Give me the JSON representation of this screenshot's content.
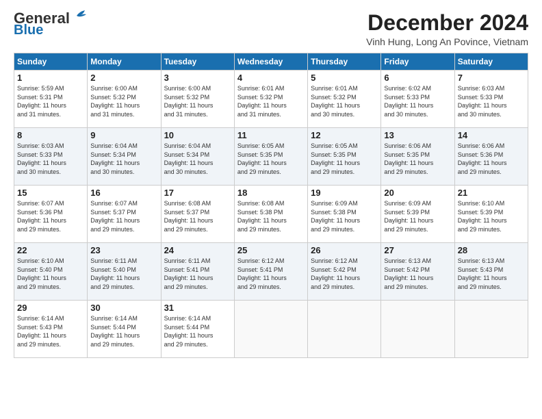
{
  "logo": {
    "general": "General",
    "blue": "Blue"
  },
  "header": {
    "month_year": "December 2024",
    "location": "Vinh Hung, Long An Povince, Vietnam"
  },
  "weekdays": [
    "Sunday",
    "Monday",
    "Tuesday",
    "Wednesday",
    "Thursday",
    "Friday",
    "Saturday"
  ],
  "weeks": [
    [
      {
        "day": "1",
        "info": "Sunrise: 5:59 AM\nSunset: 5:31 PM\nDaylight: 11 hours\nand 31 minutes."
      },
      {
        "day": "2",
        "info": "Sunrise: 6:00 AM\nSunset: 5:32 PM\nDaylight: 11 hours\nand 31 minutes."
      },
      {
        "day": "3",
        "info": "Sunrise: 6:00 AM\nSunset: 5:32 PM\nDaylight: 11 hours\nand 31 minutes."
      },
      {
        "day": "4",
        "info": "Sunrise: 6:01 AM\nSunset: 5:32 PM\nDaylight: 11 hours\nand 31 minutes."
      },
      {
        "day": "5",
        "info": "Sunrise: 6:01 AM\nSunset: 5:32 PM\nDaylight: 11 hours\nand 30 minutes."
      },
      {
        "day": "6",
        "info": "Sunrise: 6:02 AM\nSunset: 5:33 PM\nDaylight: 11 hours\nand 30 minutes."
      },
      {
        "day": "7",
        "info": "Sunrise: 6:03 AM\nSunset: 5:33 PM\nDaylight: 11 hours\nand 30 minutes."
      }
    ],
    [
      {
        "day": "8",
        "info": "Sunrise: 6:03 AM\nSunset: 5:33 PM\nDaylight: 11 hours\nand 30 minutes."
      },
      {
        "day": "9",
        "info": "Sunrise: 6:04 AM\nSunset: 5:34 PM\nDaylight: 11 hours\nand 30 minutes."
      },
      {
        "day": "10",
        "info": "Sunrise: 6:04 AM\nSunset: 5:34 PM\nDaylight: 11 hours\nand 30 minutes."
      },
      {
        "day": "11",
        "info": "Sunrise: 6:05 AM\nSunset: 5:35 PM\nDaylight: 11 hours\nand 29 minutes."
      },
      {
        "day": "12",
        "info": "Sunrise: 6:05 AM\nSunset: 5:35 PM\nDaylight: 11 hours\nand 29 minutes."
      },
      {
        "day": "13",
        "info": "Sunrise: 6:06 AM\nSunset: 5:35 PM\nDaylight: 11 hours\nand 29 minutes."
      },
      {
        "day": "14",
        "info": "Sunrise: 6:06 AM\nSunset: 5:36 PM\nDaylight: 11 hours\nand 29 minutes."
      }
    ],
    [
      {
        "day": "15",
        "info": "Sunrise: 6:07 AM\nSunset: 5:36 PM\nDaylight: 11 hours\nand 29 minutes."
      },
      {
        "day": "16",
        "info": "Sunrise: 6:07 AM\nSunset: 5:37 PM\nDaylight: 11 hours\nand 29 minutes."
      },
      {
        "day": "17",
        "info": "Sunrise: 6:08 AM\nSunset: 5:37 PM\nDaylight: 11 hours\nand 29 minutes."
      },
      {
        "day": "18",
        "info": "Sunrise: 6:08 AM\nSunset: 5:38 PM\nDaylight: 11 hours\nand 29 minutes."
      },
      {
        "day": "19",
        "info": "Sunrise: 6:09 AM\nSunset: 5:38 PM\nDaylight: 11 hours\nand 29 minutes."
      },
      {
        "day": "20",
        "info": "Sunrise: 6:09 AM\nSunset: 5:39 PM\nDaylight: 11 hours\nand 29 minutes."
      },
      {
        "day": "21",
        "info": "Sunrise: 6:10 AM\nSunset: 5:39 PM\nDaylight: 11 hours\nand 29 minutes."
      }
    ],
    [
      {
        "day": "22",
        "info": "Sunrise: 6:10 AM\nSunset: 5:40 PM\nDaylight: 11 hours\nand 29 minutes."
      },
      {
        "day": "23",
        "info": "Sunrise: 6:11 AM\nSunset: 5:40 PM\nDaylight: 11 hours\nand 29 minutes."
      },
      {
        "day": "24",
        "info": "Sunrise: 6:11 AM\nSunset: 5:41 PM\nDaylight: 11 hours\nand 29 minutes."
      },
      {
        "day": "25",
        "info": "Sunrise: 6:12 AM\nSunset: 5:41 PM\nDaylight: 11 hours\nand 29 minutes."
      },
      {
        "day": "26",
        "info": "Sunrise: 6:12 AM\nSunset: 5:42 PM\nDaylight: 11 hours\nand 29 minutes."
      },
      {
        "day": "27",
        "info": "Sunrise: 6:13 AM\nSunset: 5:42 PM\nDaylight: 11 hours\nand 29 minutes."
      },
      {
        "day": "28",
        "info": "Sunrise: 6:13 AM\nSunset: 5:43 PM\nDaylight: 11 hours\nand 29 minutes."
      }
    ],
    [
      {
        "day": "29",
        "info": "Sunrise: 6:14 AM\nSunset: 5:43 PM\nDaylight: 11 hours\nand 29 minutes."
      },
      {
        "day": "30",
        "info": "Sunrise: 6:14 AM\nSunset: 5:44 PM\nDaylight: 11 hours\nand 29 minutes."
      },
      {
        "day": "31",
        "info": "Sunrise: 6:14 AM\nSunset: 5:44 PM\nDaylight: 11 hours\nand 29 minutes."
      },
      {
        "day": "",
        "info": ""
      },
      {
        "day": "",
        "info": ""
      },
      {
        "day": "",
        "info": ""
      },
      {
        "day": "",
        "info": ""
      }
    ]
  ]
}
